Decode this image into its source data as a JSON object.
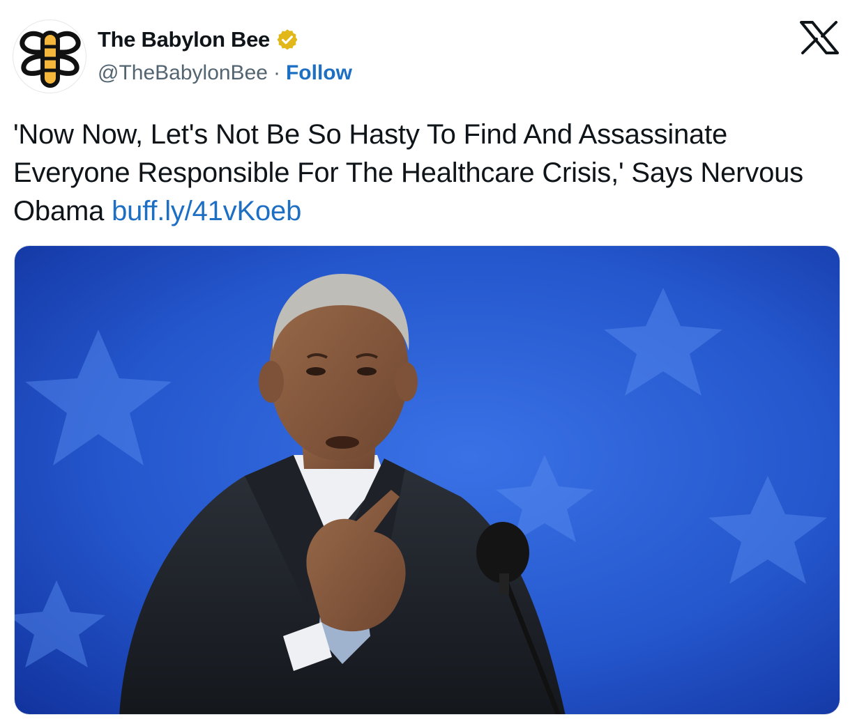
{
  "tweet": {
    "author": {
      "display_name": "The Babylon Bee",
      "handle": "@TheBabylonBee",
      "separator": "·",
      "follow_label": "Follow",
      "avatar_icon": "babylon-bee-logo",
      "verified_icon": "gold-verified-badge"
    },
    "platform_icon": "x-logo",
    "text": "'Now Now, Let's Not Be So Hasty To Find And Assassinate Everyone Responsible For The Healthcare Crisis,' Says Nervous Obama",
    "link_text": "buff.ly/41vKoeb",
    "media": {
      "kind": "photo",
      "subject": "man in dark suit speaking at a podium microphone in front of a blue star-patterned backdrop"
    }
  },
  "colors": {
    "link": "#1d6fc4",
    "text": "#0f1419",
    "muted": "#536471",
    "verified_gold": "#e2b719",
    "logo_yellow": "#f5b83d",
    "backdrop_blue": "#1f4fc0"
  }
}
